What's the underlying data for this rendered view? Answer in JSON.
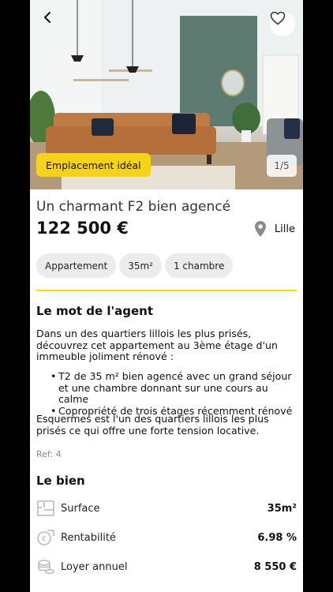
{
  "hero": {
    "tag_label": "Emplacement idéal",
    "photo_counter": "1/5",
    "back_icon": "chevron-left-icon",
    "favorite_icon": "heart-outline-icon"
  },
  "listing": {
    "title": "Un charmant F2 bien agencé",
    "price": "122 500 €",
    "city": "Lille",
    "city_icon": "location-pin-icon"
  },
  "chips": [
    {
      "label": "Appartement"
    },
    {
      "label": "35m²"
    },
    {
      "label": "1 chambre"
    }
  ],
  "agent": {
    "heading": "Le mot de l'agent",
    "intro": "Dans un des quartiers lillois les plus prisés, découvrez cet appartement au 3ème étage d'un immeuble joliment rénové :",
    "bullets": [
      "T2 de 35 m² bien agencé avec un grand séjour et une chambre donnant sur une cours au calme",
      "Copropriété de trois étages récemment rénové"
    ],
    "outro": "Esquermes est l'un des quartiers lillois les plus prisés ce qui offre une forte tension locative.",
    "ref": "Ref: 4"
  },
  "property": {
    "heading": "Le bien",
    "rows": [
      {
        "label": "Surface",
        "value": "35m²",
        "icon": "floor-plan-icon"
      },
      {
        "label": "Rentabilité",
        "value": "6.98 %",
        "icon": "euro-growth-icon"
      },
      {
        "label": "Loyer annuel",
        "value": "8 550 €",
        "icon": "coins-stack-icon"
      }
    ]
  },
  "colors": {
    "accent_yellow": "#f6d21a",
    "divider": "#f0d530",
    "chip_bg": "#ececec"
  }
}
